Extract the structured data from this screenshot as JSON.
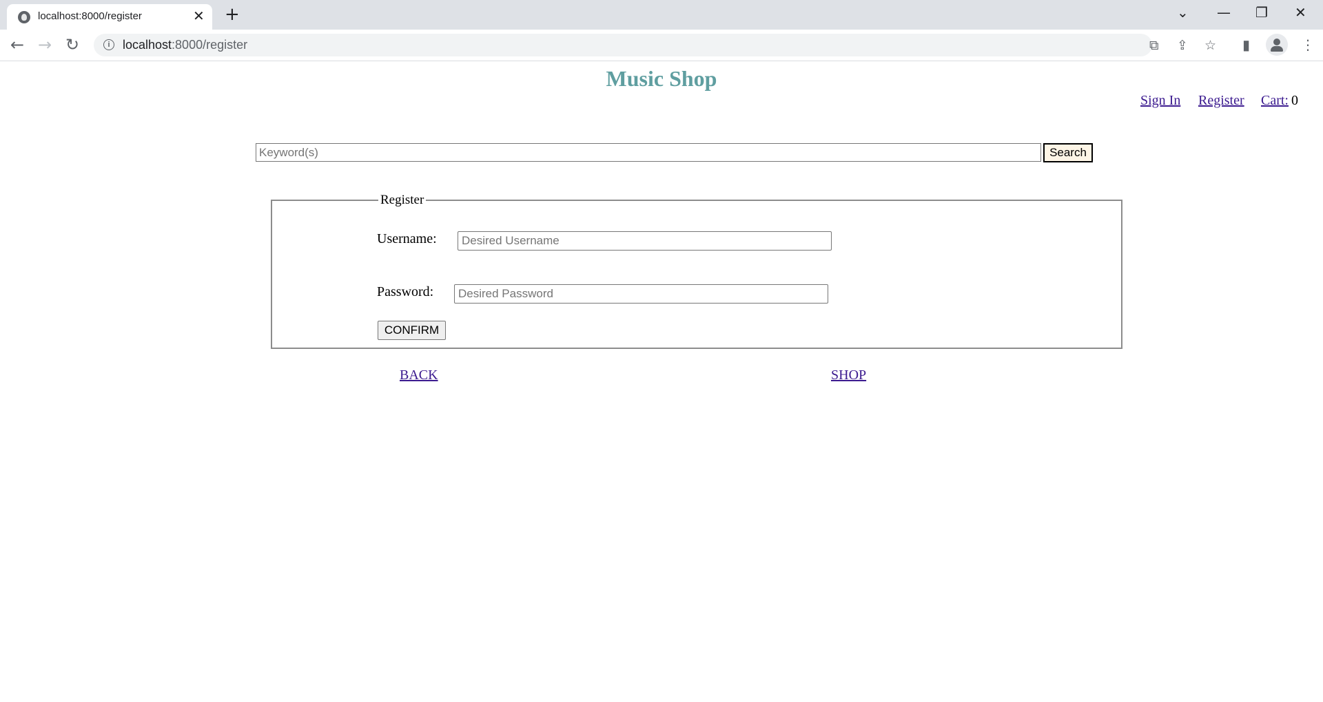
{
  "browser": {
    "tab_title": "localhost:8000/register",
    "url_host": "localhost",
    "url_rest": ":8000/register"
  },
  "page": {
    "title": "Music Shop",
    "nav": {
      "sign_in": "Sign In",
      "register": "Register",
      "cart_label": "Cart:",
      "cart_count": "0"
    },
    "search": {
      "placeholder": "Keyword(s)",
      "button": "Search"
    },
    "form": {
      "legend": "Register",
      "username_label": "Username:",
      "username_placeholder": "Desired Username",
      "password_label": "Password:",
      "password_placeholder": "Desired Password",
      "confirm": "CONFIRM"
    },
    "links": {
      "back": "BACK",
      "shop": "SHOP"
    }
  },
  "colors": {
    "title": "#5f9ea0",
    "link": "#3b1a8f",
    "search_button_bg": "#fdf5e6"
  }
}
